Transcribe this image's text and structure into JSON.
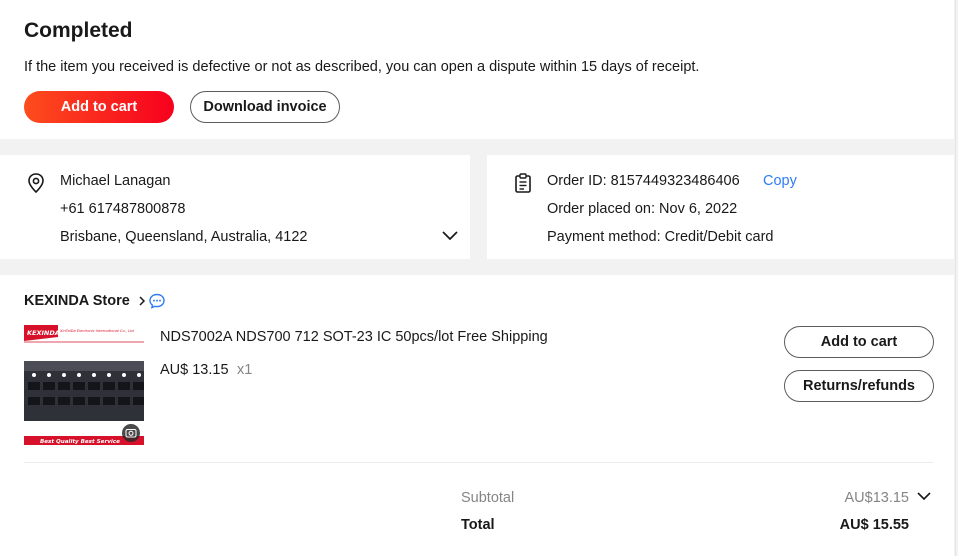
{
  "status": {
    "title": "Completed",
    "notice": "If the item you received is defective or not as described, you can open a dispute within 15 days of receipt.",
    "add_to_cart_label": "Add to cart",
    "download_invoice_label": "Download invoice"
  },
  "address": {
    "name": "Michael Lanagan",
    "phone": "+61 617487800878",
    "location": "Brisbane, Queensland, Australia, 4122"
  },
  "order": {
    "id_text": "Order ID: 8157449323486406",
    "copy_label": "Copy",
    "placed_text": "Order placed on: Nov 6, 2022",
    "payment_text": "Payment method: Credit/Debit card"
  },
  "store": {
    "name": "KEXINDA Store",
    "chevron": ">"
  },
  "item": {
    "title": "NDS7002A NDS700 712 SOT-23 IC 50pcs/lot Free Shipping",
    "price": "AU$ 13.15",
    "quantity": "x1",
    "add_to_cart_label": "Add to cart",
    "returns_label": "Returns/refunds",
    "thumb_brand": "KEXINDA",
    "thumb_company": "XinTaiDa Electronic International Co., Ltd",
    "thumb_banner": "Best Quality  Best Service"
  },
  "summary": {
    "subtotal_label": "Subtotal",
    "subtotal_value": "AU$13.15",
    "total_label": "Total",
    "total_value": "AU$ 15.55"
  },
  "colors": {
    "accent_start": "#fd4d1d",
    "accent_end": "#f7001e",
    "link": "#2e7cf6",
    "thumb_banner": "#d8112a"
  },
  "icons": {
    "location": "location-pin-icon",
    "order": "clipboard-icon",
    "message": "chat-bubble-icon",
    "expand": "chevron-down-icon",
    "camera": "camera-icon"
  }
}
